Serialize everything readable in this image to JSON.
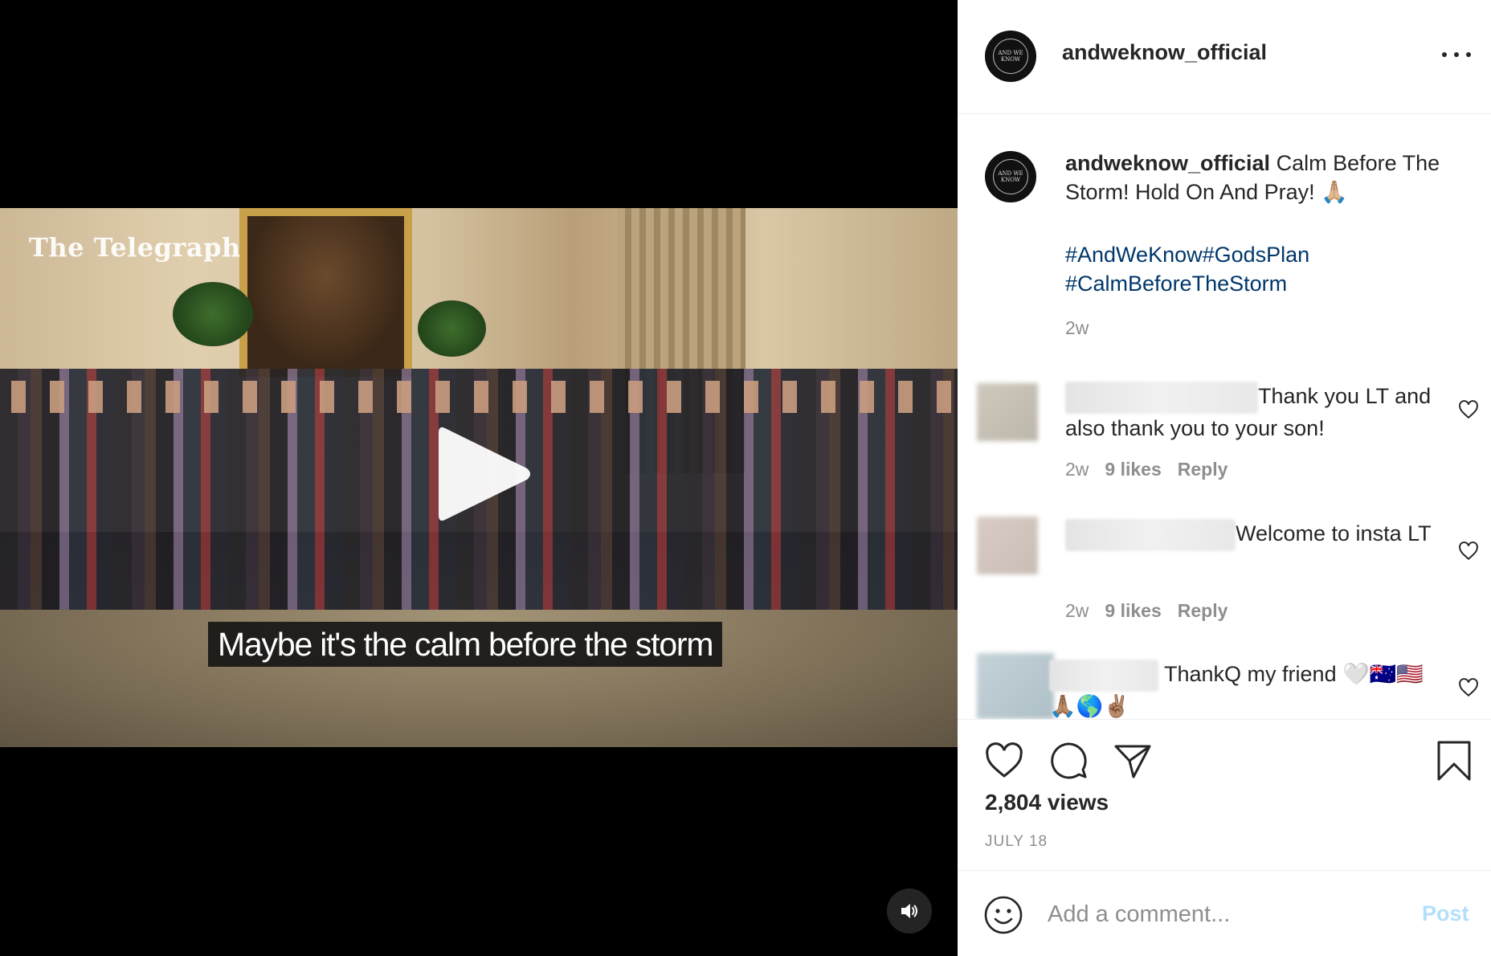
{
  "video": {
    "watermark": "The Telegraph",
    "subtitle": "Maybe it's the calm before the storm"
  },
  "post": {
    "username": "andweknow_official",
    "avatar_text": "AND WE KNOW"
  },
  "caption": {
    "username": "andweknow_official",
    "text": "Calm Before The Storm! Hold On And Pray! 🙏🏼",
    "hashtags": [
      "#AndWeKnow",
      "#GodsPlan",
      "#CalmBeforeTheStorm"
    ],
    "time": "2w"
  },
  "comments": [
    {
      "text": "Thank you LT and also thank you to your son!",
      "time": "2w",
      "likes": "9 likes",
      "reply": "Reply"
    },
    {
      "text": "Welcome to insta LT",
      "time": "2w",
      "likes": "9 likes",
      "reply": "Reply"
    },
    {
      "text": "ThankQ my friend 🤍🇦🇺🇺🇸 🙏🏽🌎✌🏽"
    }
  ],
  "stats": {
    "views": "2,804 views",
    "date": "JULY 18"
  },
  "comment_box": {
    "placeholder": "Add a comment...",
    "post_label": "Post"
  },
  "colors": {
    "hashtag": "#00376b",
    "muted": "#8e8e8e",
    "post_disabled": "#b2dffc"
  }
}
